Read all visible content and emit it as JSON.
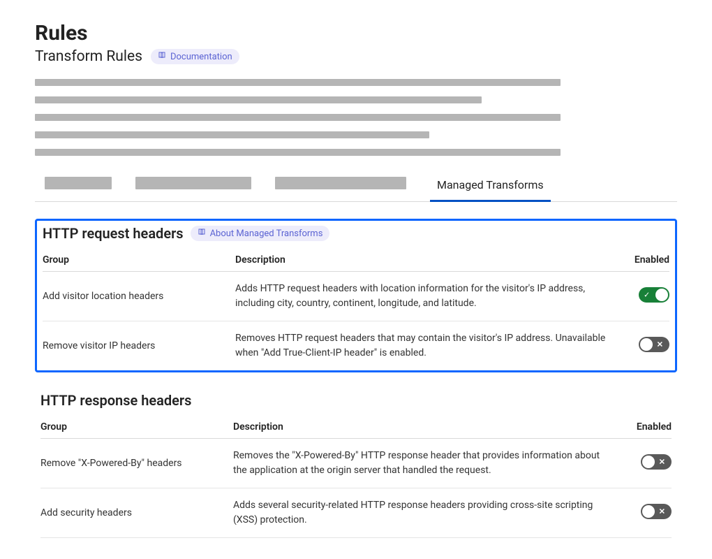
{
  "header": {
    "title": "Rules",
    "subtitle": "Transform Rules",
    "doc_link": "Documentation"
  },
  "tabs": {
    "active": "Managed Transforms"
  },
  "sections": {
    "request": {
      "title": "HTTP request headers",
      "about_link": "About Managed Transforms",
      "columns": {
        "group": "Group",
        "description": "Description",
        "enabled": "Enabled"
      },
      "rows": [
        {
          "group": "Add visitor location headers",
          "description": "Adds HTTP request headers with location information for the visitor's IP address, including city, country, continent, longitude, and latitude.",
          "enabled": true
        },
        {
          "group": "Remove visitor IP headers",
          "description": "Removes HTTP request headers that may contain the visitor's IP address. Unavailable when \"Add True-Client-IP header\" is enabled.",
          "enabled": false
        }
      ]
    },
    "response": {
      "title": "HTTP response headers",
      "columns": {
        "group": "Group",
        "description": "Description",
        "enabled": "Enabled"
      },
      "rows": [
        {
          "group": "Remove \"X-Powered-By\" headers",
          "description": "Removes the \"X-Powered-By\" HTTP response header that provides information about the application at the origin server that handled the request.",
          "enabled": false
        },
        {
          "group": "Add security headers",
          "description": "Adds several security-related HTTP response headers providing cross-site scripting (XSS) protection.",
          "enabled": false
        }
      ]
    }
  }
}
